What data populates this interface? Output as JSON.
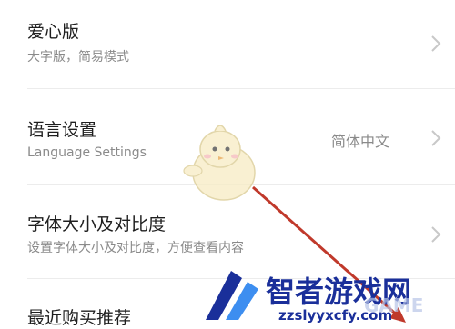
{
  "settings": {
    "items": [
      {
        "title": "爱心版",
        "subtitle": "大字版，简易模式"
      },
      {
        "title": "语言设置",
        "subtitle": "Language Settings",
        "value": "简体中文"
      },
      {
        "title": "字体大小及对比度",
        "subtitle": "设置字体大小及对比度，方便查看内容"
      },
      {
        "title": "最近购买推荐"
      }
    ]
  },
  "overlay": {
    "mascot_icon": "chick-mascot-icon",
    "arrow_color": "#c0392b"
  },
  "watermark": {
    "brand": "智者游戏网",
    "url": "zzslyyxcfy.com",
    "faded": "GAME",
    "brand_color": "#1a2f9a"
  }
}
